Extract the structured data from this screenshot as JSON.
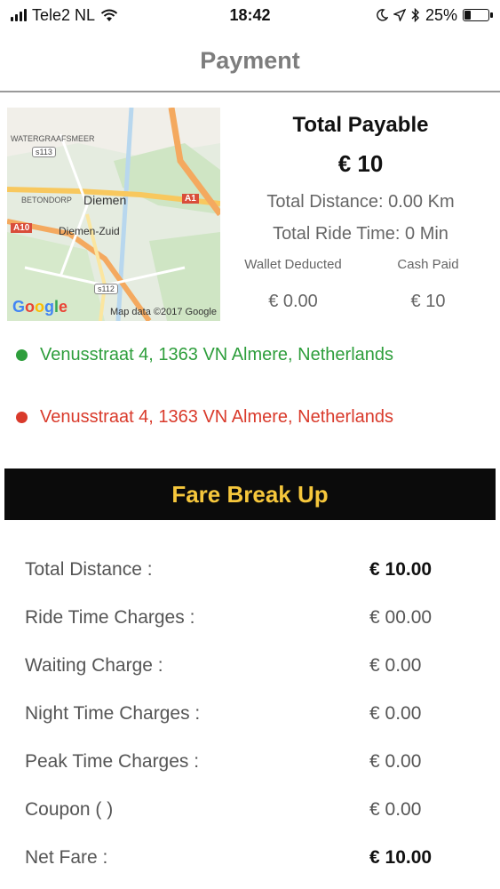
{
  "status_bar": {
    "carrier": "Tele2 NL",
    "time": "18:42",
    "battery_percent": "25%",
    "battery_level": 0.25
  },
  "nav": {
    "title": "Payment"
  },
  "map": {
    "labels": {
      "watergraafsmeer": "WATERGRAAFSMEER",
      "s113": "s113",
      "betondorp": "BETONDORP",
      "diemen": "Diemen",
      "a1": "A1",
      "a10": "A10",
      "diemen_zuid": "Diemen-Zuid",
      "s112": "s112"
    },
    "google_logo": [
      "G",
      "o",
      "o",
      "g",
      "l",
      "e"
    ],
    "attribution": "Map data ©2017 Google"
  },
  "summary": {
    "title": "Total Payable",
    "amount": "€ 10",
    "total_distance": "Total Distance: 0.00 Km",
    "total_ride_time": "Total Ride Time: 0 Min",
    "wallet_label": "Wallet Deducted",
    "wallet_value": "€ 0.00",
    "cash_label": "Cash Paid",
    "cash_value": "€ 10"
  },
  "pickup_address": "Venusstraat 4, 1363 VN Almere, Netherlands",
  "drop_address": "Venusstraat 4, 1363 VN Almere, Netherlands",
  "colors": {
    "pickup": "#2e9e3c",
    "drop": "#d93a2b",
    "fare_header_bg": "#0b0b0b",
    "fare_header_text": "#f6c73c"
  },
  "fare_breakup": {
    "title": "Fare Break Up",
    "rows": [
      {
        "label": "Total Distance :",
        "value": "€ 10.00"
      },
      {
        "label": "Ride Time Charges :",
        "value": "€ 00.00"
      },
      {
        "label": "Waiting Charge :",
        "value": "€ 0.00"
      },
      {
        "label": "Night Time Charges :",
        "value": "€ 0.00"
      },
      {
        "label": "Peak Time Charges :",
        "value": "€ 0.00"
      },
      {
        "label": "Coupon ( )",
        "value": "€ 0.00"
      },
      {
        "label": "Net Fare :",
        "value": "€ 10.00"
      }
    ]
  }
}
